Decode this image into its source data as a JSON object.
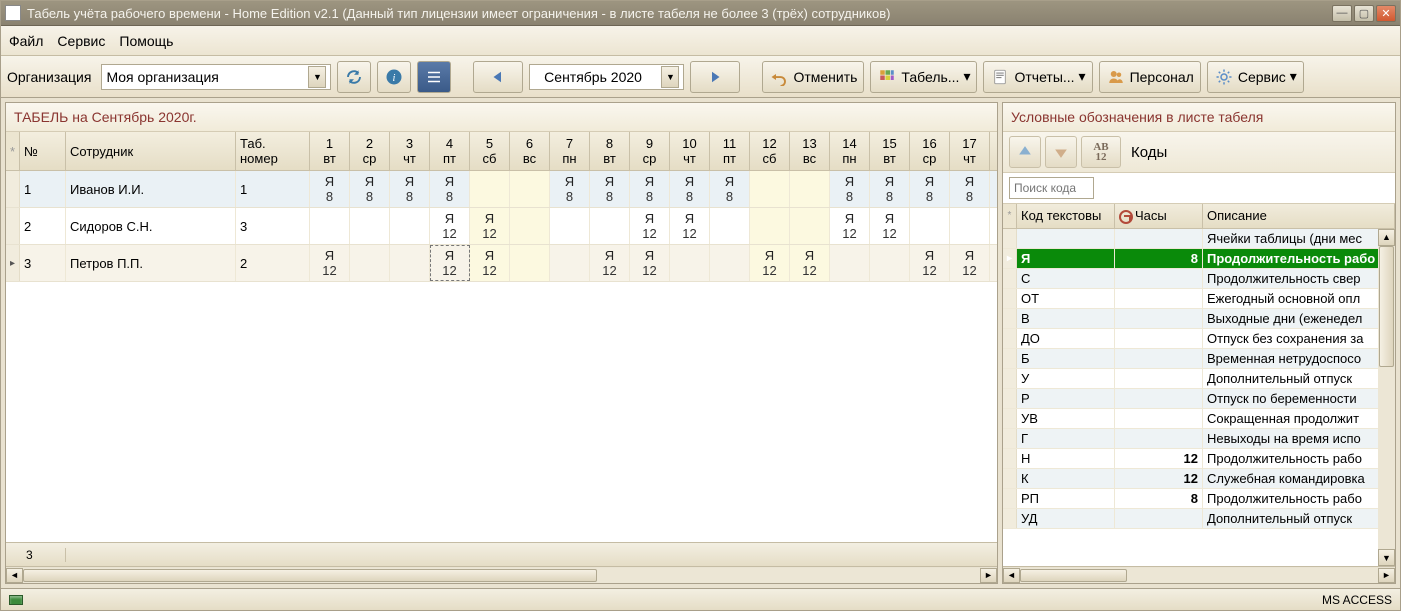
{
  "window": {
    "title": "Табель учёта рабочего времени - Home Edition v2.1 (Данный тип лицензии имеет ограничения - в листе табеля не более 3 (трёх) сотрудников)"
  },
  "menubar": {
    "file": "Файл",
    "service": "Сервис",
    "help": "Помощь"
  },
  "toolbar": {
    "org_label": "Организация",
    "org_value": "Моя организация",
    "month_value": "Сентябрь 2020",
    "undo": "Отменить",
    "tabel": "Табель...",
    "reports": "Отчеты...",
    "personnel": "Персонал",
    "service_btn": "Сервис"
  },
  "timesheet": {
    "title": "ТАБЕЛЬ на Сентябрь 2020г.",
    "footer_count": "3",
    "columns": {
      "num": "№",
      "emp": "Сотрудник",
      "tab": "Таб. номер",
      "days": [
        {
          "d": "1",
          "w": "вт"
        },
        {
          "d": "2",
          "w": "ср"
        },
        {
          "d": "3",
          "w": "чт"
        },
        {
          "d": "4",
          "w": "пт"
        },
        {
          "d": "5",
          "w": "сб",
          "we": true
        },
        {
          "d": "6",
          "w": "вс",
          "we": true
        },
        {
          "d": "7",
          "w": "пн"
        },
        {
          "d": "8",
          "w": "вт"
        },
        {
          "d": "9",
          "w": "ср"
        },
        {
          "d": "10",
          "w": "чт"
        },
        {
          "d": "11",
          "w": "пт"
        },
        {
          "d": "12",
          "w": "сб",
          "we": true
        },
        {
          "d": "13",
          "w": "вс",
          "we": true
        },
        {
          "d": "14",
          "w": "пн"
        },
        {
          "d": "15",
          "w": "вт"
        },
        {
          "d": "16",
          "w": "ср"
        },
        {
          "d": "17",
          "w": "чт"
        }
      ]
    },
    "rows": [
      {
        "num": "1",
        "emp": "Иванов И.И.",
        "tab": "1",
        "current": false,
        "days": [
          {
            "c": "Я",
            "h": "8"
          },
          {
            "c": "Я",
            "h": "8"
          },
          {
            "c": "Я",
            "h": "8"
          },
          {
            "c": "Я",
            "h": "8"
          },
          {},
          {},
          {
            "c": "Я",
            "h": "8"
          },
          {
            "c": "Я",
            "h": "8"
          },
          {
            "c": "Я",
            "h": "8"
          },
          {
            "c": "Я",
            "h": "8"
          },
          {
            "c": "Я",
            "h": "8"
          },
          {},
          {},
          {
            "c": "Я",
            "h": "8"
          },
          {
            "c": "Я",
            "h": "8"
          },
          {
            "c": "Я",
            "h": "8"
          },
          {
            "c": "Я",
            "h": "8"
          }
        ]
      },
      {
        "num": "2",
        "emp": "Сидоров С.Н.",
        "tab": "3",
        "current": false,
        "days": [
          {},
          {},
          {},
          {
            "c": "Я",
            "h": "12"
          },
          {
            "c": "Я",
            "h": "12"
          },
          {},
          {},
          {},
          {
            "c": "Я",
            "h": "12"
          },
          {
            "c": "Я",
            "h": "12"
          },
          {},
          {},
          {},
          {
            "c": "Я",
            "h": "12"
          },
          {
            "c": "Я",
            "h": "12"
          },
          {},
          {}
        ]
      },
      {
        "num": "3",
        "emp": "Петров П.П.",
        "tab": "2",
        "current": true,
        "sel_day": 3,
        "days": [
          {
            "c": "Я",
            "h": "12"
          },
          {},
          {},
          {
            "c": "Я",
            "h": "12"
          },
          {
            "c": "Я",
            "h": "12"
          },
          {},
          {},
          {
            "c": "Я",
            "h": "12"
          },
          {
            "c": "Я",
            "h": "12"
          },
          {},
          {},
          {
            "c": "Я",
            "h": "12"
          },
          {
            "c": "Я",
            "h": "12"
          },
          {},
          {},
          {
            "c": "Я",
            "h": "12"
          },
          {
            "c": "Я",
            "h": "12"
          }
        ]
      }
    ]
  },
  "legend": {
    "title": "Условные обозначения в листе табеля",
    "codes_label": "Коды",
    "search_placeholder": "Поиск кода",
    "cols": {
      "code": "Код текстовы",
      "hours": "Часы",
      "desc": "Описание"
    },
    "rows": [
      {
        "code": "",
        "hours": "",
        "desc": "Ячейки таблицы (дни мес"
      },
      {
        "code": "Я",
        "hours": "8",
        "desc": "Продолжительность рабо",
        "selected": true
      },
      {
        "code": "С",
        "hours": "",
        "desc": "Продолжительность свер"
      },
      {
        "code": "ОТ",
        "hours": "",
        "desc": "Ежегодный основной опл"
      },
      {
        "code": "В",
        "hours": "",
        "desc": "Выходные дни (еженедел"
      },
      {
        "code": "ДО",
        "hours": "",
        "desc": "Отпуск без сохранения за"
      },
      {
        "code": "Б",
        "hours": "",
        "desc": "Временная нетрудоспосо"
      },
      {
        "code": "У",
        "hours": "",
        "desc": "Дополнительный отпуск"
      },
      {
        "code": "Р",
        "hours": "",
        "desc": "Отпуск по беременности"
      },
      {
        "code": "УВ",
        "hours": "",
        "desc": "Сокращенная продолжит"
      },
      {
        "code": "Г",
        "hours": "",
        "desc": "Невыходы на время испо"
      },
      {
        "code": "Н",
        "hours": "12",
        "desc": "Продолжительность рабо"
      },
      {
        "code": "К",
        "hours": "12",
        "desc": "Служебная командировка"
      },
      {
        "code": "РП",
        "hours": "8",
        "desc": "Продолжительность рабо"
      },
      {
        "code": "УД",
        "hours": "",
        "desc": "Дополнительный отпуск"
      }
    ]
  },
  "statusbar": {
    "db": "MS ACCESS"
  }
}
